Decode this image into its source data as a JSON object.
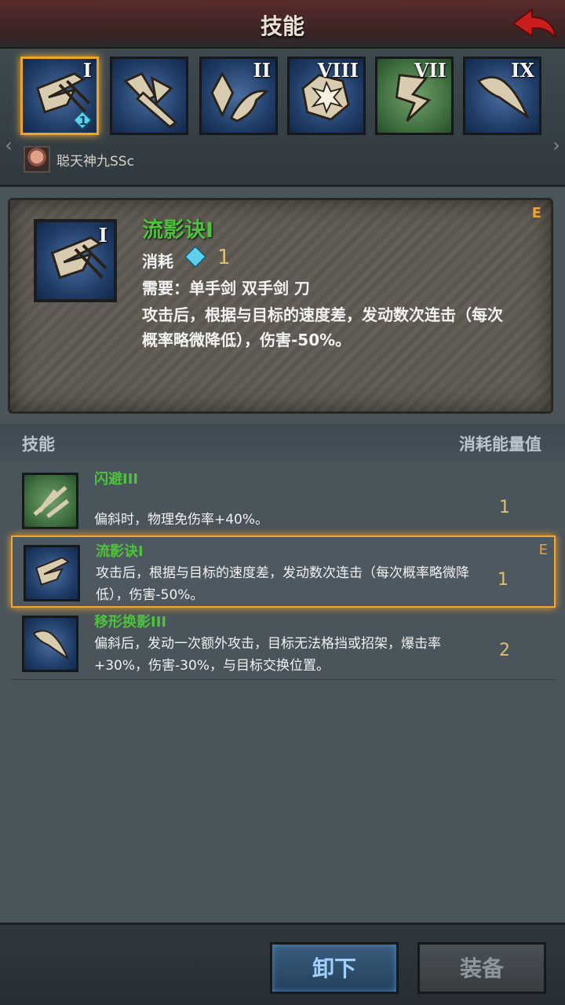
{
  "header": {
    "title": "技能"
  },
  "skill_slots": [
    {
      "rank": "I",
      "color": "blue",
      "selected": true,
      "cost": "1"
    },
    {
      "rank": "",
      "color": "blue",
      "selected": false
    },
    {
      "rank": "II",
      "color": "blue",
      "selected": false
    },
    {
      "rank": "VIII",
      "color": "blue",
      "selected": false
    },
    {
      "rank": "VII",
      "color": "green",
      "selected": false
    },
    {
      "rank": "IX",
      "color": "blue",
      "selected": false
    }
  ],
  "character": {
    "name": "聪天神九SSc"
  },
  "detail": {
    "rank": "I",
    "name": "流影诀I",
    "grade": "E",
    "cost_label": "消耗",
    "cost_value": "1",
    "requirement": "需要：单手剑  双手剑  刀",
    "description": "攻击后，根据与目标的速度差，发动数次连击（每次概率略微降低），伤害-50%。"
  },
  "list_header": {
    "left": "技能",
    "right": "消耗能量值"
  },
  "skill_list": [
    {
      "name": "闪避III",
      "desc": "偏斜时，物理免伤率+40%。",
      "cost": "1",
      "grade": "",
      "color": "green",
      "selected": false
    },
    {
      "name": "流影诀I",
      "desc": "攻击后，根据与目标的速度差，发动数次连击（每次概率略微降低），伤害-50%。",
      "cost": "1",
      "grade": "E",
      "color": "blue",
      "selected": true
    },
    {
      "name": "移形换影III",
      "desc": "偏斜后，发动一次额外攻击，目标无法格挡或招架，爆击率+30%，伤害-30%，与目标交换位置。",
      "cost": "2",
      "grade": "",
      "color": "blue",
      "selected": false
    }
  ],
  "buttons": {
    "unequip": "卸下",
    "equip": "装备"
  },
  "colors": {
    "accent": "#f5a52a",
    "skill_name": "#4ec23a",
    "cost": "#e0c070"
  }
}
